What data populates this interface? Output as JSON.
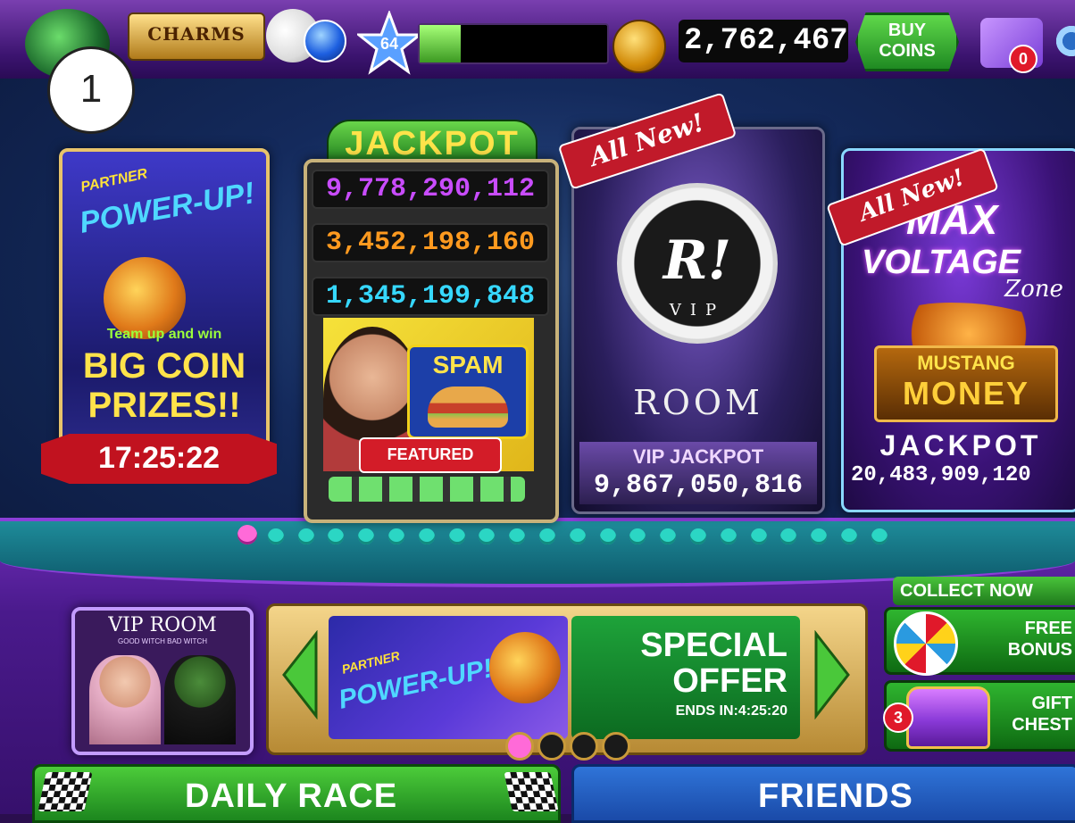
{
  "top_bar": {
    "logo_text": "CHARMS",
    "level": "64",
    "coins": "2,762,467",
    "buy_coins": [
      "BUY",
      "COINS"
    ],
    "gift_count": "0"
  },
  "step_badge": "1",
  "cards": {
    "partner": {
      "partner_label": "PARTNER",
      "title": "POWER-UP!",
      "subtitle": "Team up and win",
      "prize_line1": "BIG COIN",
      "prize_line2": "PRIZES!!",
      "timer": "17:25:22"
    },
    "jackpot": {
      "title": "JACKPOT",
      "values": [
        "9,778,290,112",
        "3,452,198,160",
        "1,345,199,848"
      ],
      "brand": "SPAM",
      "featured": "FEATURED"
    },
    "vip": {
      "ribbon": "All New!",
      "emblem_letter": "R!",
      "emblem_text": "VIP",
      "room": "ROOM",
      "jackpot_label": "VIP JACKPOT",
      "jackpot_value": "9,867,050,816"
    },
    "max": {
      "ribbon": "All New!",
      "title1": "MAX",
      "title2": "VOLTAGE",
      "title3": "Zone",
      "game1": "MUSTANG",
      "game2": "MONEY",
      "jackpot_label": "JACKPOT",
      "jackpot_value": "20,483,909,120"
    }
  },
  "pagination": {
    "total": 22,
    "active": 0
  },
  "vip_room": {
    "label": "VIP ROOM",
    "caption": "GOOD WITCH BAD WITCH"
  },
  "offer": {
    "partner_label": "PARTNER",
    "partner_title": "POWER-UP!",
    "line1": "SPECIAL",
    "line2": "OFFER",
    "ends": "ENDS IN:4:25:20",
    "dots_total": 4,
    "dots_active": 0
  },
  "collect": {
    "header": "COLLECT NOW",
    "bonus1": "FREE",
    "bonus2": "BONUS",
    "chest_count": "3",
    "chest1": "GIFT",
    "chest2": "CHEST"
  },
  "bottom": {
    "daily_race": "DAILY RACE",
    "friends": "FRIENDS"
  },
  "colors": {
    "accent_green": "#2fb52f",
    "friends_blue": "#1d5fc4",
    "jackpot_purple": "#c94cff",
    "jackpot_orange": "#ff9a1f",
    "jackpot_cyan": "#36d8ff"
  }
}
